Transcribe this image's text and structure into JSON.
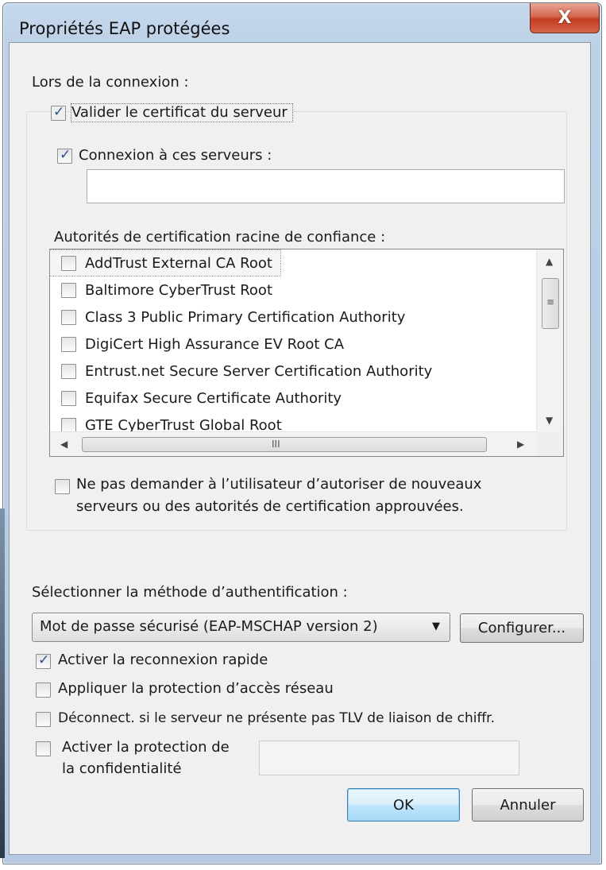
{
  "window": {
    "title": "Propriétés EAP protégées",
    "close_label": "X"
  },
  "connection": {
    "heading": "Lors de la connexion :",
    "validate_cert": {
      "label": "Valider le certificat du serveur",
      "checked": true
    },
    "connect_servers": {
      "label": "Connexion à ces serveurs :",
      "checked": true,
      "value": ""
    },
    "root_ca_label": "Autorités de certification racine de confiance :",
    "root_cas": [
      {
        "label": "AddTrust External CA Root",
        "checked": false
      },
      {
        "label": "Baltimore CyberTrust Root",
        "checked": false
      },
      {
        "label": "Class 3 Public Primary Certification Authority",
        "checked": false
      },
      {
        "label": "DigiCert High Assurance EV Root CA",
        "checked": false
      },
      {
        "label": "Entrust.net Secure Server Certification Authority",
        "checked": false
      },
      {
        "label": "Equifax Secure Certificate Authority",
        "checked": false
      },
      {
        "label": "GTE CyberTrust Global Root",
        "checked": false
      }
    ],
    "hscroll_grip": "III",
    "dont_prompt": {
      "line1": "Ne pas demander à l’utilisateur d’autoriser de nouveaux",
      "line2": "serveurs ou des autorités de certification approuvées.",
      "checked": false
    }
  },
  "auth": {
    "label": "Sélectionner la méthode d’authentification :",
    "method_selected": "Mot de passe sécurisé (EAP-MSCHAP version 2)",
    "configure_label": "Configurer..."
  },
  "options": {
    "fast_reconnect": {
      "label": "Activer la reconnexion rapide",
      "checked": true
    },
    "nap": {
      "label": "Appliquer la protection d’accès réseau",
      "checked": false
    },
    "disconnect_tlv": {
      "label": "Déconnect. si le serveur ne présente pas TLV de liaison de chiffr.",
      "checked": false
    },
    "privacy": {
      "line1": "Activer la protection de",
      "line2": "la confidentialité",
      "checked": false,
      "value": ""
    }
  },
  "buttons": {
    "ok": "OK",
    "cancel": "Annuler"
  },
  "icons": {
    "check": "checkmark-icon",
    "dropdown": "chevron-down-icon",
    "scroll_up": "arrow-up-icon",
    "scroll_down": "arrow-down-icon",
    "scroll_left": "arrow-left-icon",
    "scroll_right": "arrow-right-icon"
  },
  "colors": {
    "title_bar": "#bcd0e6",
    "close_button": "#c94a30",
    "client_area": "#f0f0f0",
    "check_mark": "#2a4f90"
  }
}
